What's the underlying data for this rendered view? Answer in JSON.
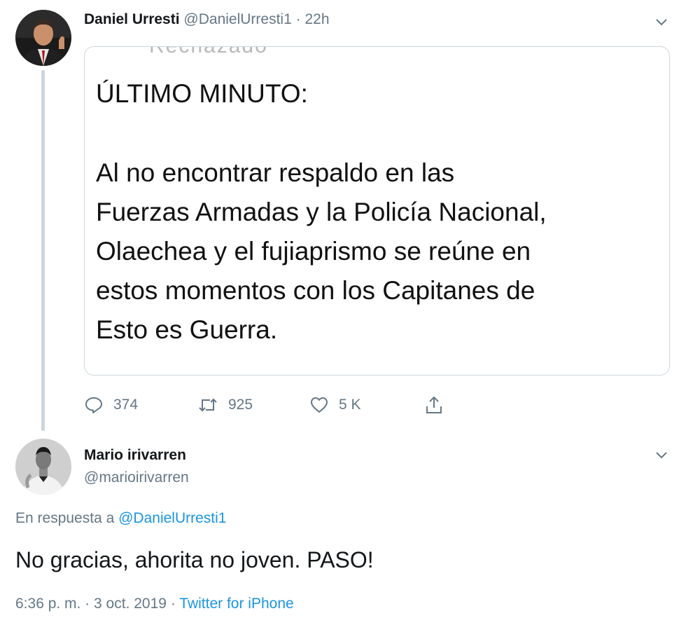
{
  "tweet": {
    "author_name": "Daniel Urresti",
    "handle": "@DanielUrresti1",
    "separator": "·",
    "time": "22h",
    "quote": {
      "cut_off_text": "Rechazado",
      "title": "ÚLTIMO MINUTO:",
      "body": "Al no encontrar respaldo en las\nFuerzas Armadas y la Policía Nacional,\nOlaechea y el fujiaprismo se reúne en\nestos momentos con los Capitanes de\nEsto es Guerra."
    },
    "actions": {
      "replies": "374",
      "retweets": "925",
      "likes": "5 K"
    }
  },
  "reply": {
    "author_name": "Mario irivarren",
    "handle": "@marioirivarren",
    "in_reply_prefix": "En respuesta a",
    "in_reply_handle": "@DanielUrresti1",
    "text": "No gracias, ahorita no joven. PASO!",
    "timestamp": "6:36 p. m. · 3 oct. 2019",
    "separator": "·",
    "source": "Twitter for iPhone"
  },
  "icons": {
    "caret": "chevron-down-icon",
    "reply": "reply-icon",
    "retweet": "retweet-icon",
    "like": "heart-icon",
    "share": "share-icon"
  },
  "colors": {
    "link": "#1b95e0",
    "muted": "#657786",
    "border": "#ccd6dd",
    "text": "#14171a"
  }
}
